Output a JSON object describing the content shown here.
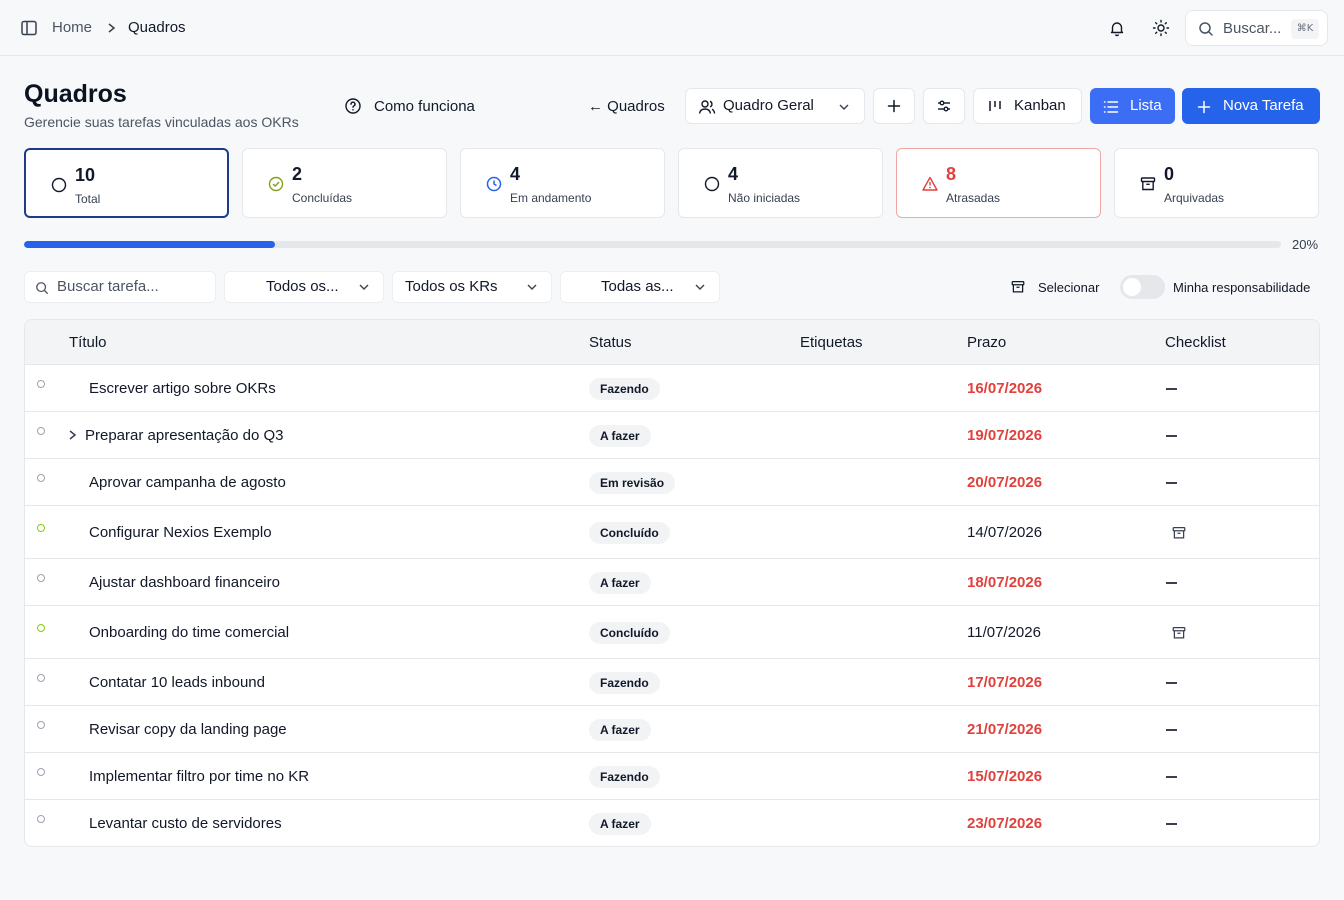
{
  "breadcrumb": {
    "home": "Home",
    "current": "Quadros"
  },
  "topbar": {
    "search_label": "Buscar...",
    "search_shortcut": "⌘K"
  },
  "header": {
    "title": "Quadros",
    "subtitle": "Gerencie suas tarefas vinculadas aos OKRs",
    "how_it_works": "Como funciona",
    "back_label": "← Quadros",
    "board_select": "Quadro Geral",
    "kanban_label": "Kanban",
    "list_label": "Lista",
    "new_task_label": "Nova Tarefa"
  },
  "stats": [
    {
      "value": "10",
      "label": "Total",
      "icon": "circle-icon"
    },
    {
      "value": "2",
      "label": "Concluídas",
      "icon": "check-circle-icon"
    },
    {
      "value": "4",
      "label": "Em andamento",
      "icon": "clock-icon"
    },
    {
      "value": "4",
      "label": "Não iniciadas",
      "icon": "circle-icon"
    },
    {
      "value": "8",
      "label": "Atrasadas",
      "icon": "alert-triangle-icon"
    },
    {
      "value": "0",
      "label": "Arquivadas",
      "icon": "archive-icon"
    }
  ],
  "progress": {
    "value": 0.2,
    "label": "20%"
  },
  "filters": {
    "search_placeholder": "Buscar tarefa...",
    "filter1": "Todos os...",
    "filter2": "Todos os KRs",
    "filter3": "Todas as...",
    "select_label": "Selecionar",
    "mine_label": "Minha responsabilidade"
  },
  "table": {
    "columns": [
      "Título",
      "Status",
      "Etiquetas",
      "Prazo",
      "Checklist"
    ],
    "rows": [
      {
        "title": "Escrever artigo sobre OKRs",
        "status": "Fazendo",
        "due": "16/07/2026",
        "late": true,
        "done": false,
        "checklist": "—",
        "expand": false
      },
      {
        "title": "Preparar apresentação do Q3",
        "status": "A fazer",
        "due": "19/07/2026",
        "late": true,
        "done": false,
        "checklist": "—",
        "expand": true
      },
      {
        "title": "Aprovar campanha de agosto",
        "status": "Em revisão",
        "due": "20/07/2026",
        "late": true,
        "done": false,
        "checklist": "—",
        "expand": false
      },
      {
        "title": "Configurar Nexios Exemplo",
        "status": "Concluído",
        "due": "14/07/2026",
        "late": false,
        "done": true,
        "checklist": "archive-icon",
        "expand": false
      },
      {
        "title": "Ajustar dashboard financeiro",
        "status": "A fazer",
        "due": "18/07/2026",
        "late": true,
        "done": false,
        "checklist": "—",
        "expand": false
      },
      {
        "title": "Onboarding do time comercial",
        "status": "Concluído",
        "due": "11/07/2026",
        "late": false,
        "done": true,
        "checklist": "archive-icon",
        "expand": false
      },
      {
        "title": "Contatar 10 leads inbound",
        "status": "Fazendo",
        "due": "17/07/2026",
        "late": true,
        "done": false,
        "checklist": "—",
        "expand": false
      },
      {
        "title": "Revisar copy da landing page",
        "status": "A fazer",
        "due": "21/07/2026",
        "late": true,
        "done": false,
        "checklist": "—",
        "expand": false
      },
      {
        "title": "Implementar filtro por time no KR",
        "status": "Fazendo",
        "due": "15/07/2026",
        "late": true,
        "done": false,
        "checklist": "—",
        "expand": false
      },
      {
        "title": "Levantar custo de servidores",
        "status": "A fazer",
        "due": "23/07/2026",
        "late": true,
        "done": false,
        "checklist": "—",
        "expand": false
      }
    ]
  },
  "colors": {
    "primary": "#2563eb",
    "danger": "#e0413d",
    "success": "#84cc16",
    "active_border": "#1e3a8a"
  }
}
